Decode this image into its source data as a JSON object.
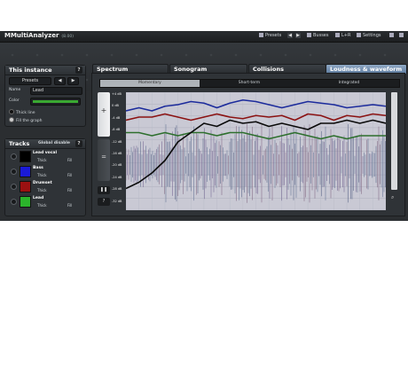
{
  "app": {
    "title": "MMultiAnalyzer",
    "version": "(8.00)"
  },
  "toolbar": {
    "presets_label": "Presets",
    "busses_label": "Busses",
    "lr_label": "L+R",
    "settings_label": "Settings"
  },
  "instance": {
    "header": "This instance",
    "help": "?",
    "presets_label": "Presets",
    "name_label": "Name",
    "name_value": "Lead",
    "color_label": "Color",
    "color_value": "#3aa832",
    "thick_line_label": "Thick line",
    "fill_graph_label": "Fill the graph"
  },
  "tracks": {
    "header": "Tracks",
    "global_label": "Global disable",
    "help": "?",
    "thick_label": "Thick",
    "fill_label": "Fill",
    "items": [
      {
        "name": "Lead vocal",
        "color": "#000000"
      },
      {
        "name": "Bass",
        "color": "#1a1ad6"
      },
      {
        "name": "Drumset",
        "color": "#9b1111"
      },
      {
        "name": "Lead",
        "color": "#2bb32b"
      }
    ]
  },
  "tabs": [
    {
      "label": "Spectrum",
      "active": false
    },
    {
      "label": "Sonogram",
      "active": false
    },
    {
      "label": "Collisions",
      "active": false
    },
    {
      "label": "Loudness & waveform",
      "active": true
    }
  ],
  "subtabs": [
    {
      "label": "Momentary",
      "active": true
    },
    {
      "label": "Short-term",
      "active": false
    },
    {
      "label": "Integrated",
      "active": false
    }
  ],
  "y_axis_labels": [
    "+4 dB",
    "0 dB",
    "-4 dB",
    "-8 dB",
    "-12 dB",
    "-16 dB",
    "-20 dB",
    "-24 dB",
    "-28 dB",
    "-32 dB"
  ],
  "chart_data": {
    "type": "line",
    "title": "",
    "xlabel": "",
    "ylabel": "",
    "ylim": [
      -34,
      4
    ],
    "x": [
      0,
      1,
      2,
      3,
      4,
      5,
      6,
      7,
      8,
      9,
      10,
      11,
      12,
      13,
      14,
      15,
      16,
      17,
      18,
      19,
      20
    ],
    "series": [
      {
        "color": "#1c2b9c",
        "values": [
          -2,
          -1,
          -2,
          -0.5,
          0,
          1,
          0.5,
          -1,
          0.5,
          1.5,
          1,
          0,
          -1,
          0,
          1,
          0.5,
          0,
          -1,
          -0.5,
          0,
          -0.5
        ]
      },
      {
        "color": "#8b1212",
        "values": [
          -5,
          -4,
          -4,
          -3,
          -4,
          -5,
          -4,
          -3,
          -4,
          -4.5,
          -3.5,
          -4,
          -3.5,
          -5,
          -3,
          -3.5,
          -5,
          -3.5,
          -4,
          -3,
          -3.5
        ]
      },
      {
        "color": "#2d6f2d",
        "values": [
          -9,
          -9,
          -10,
          -9,
          -10,
          -9,
          -9,
          -10,
          -9,
          -9,
          -10,
          -11,
          -10,
          -9,
          -10,
          -11,
          -10,
          -11,
          -10,
          -10,
          -10
        ]
      },
      {
        "color": "#0a0a0a",
        "values": [
          -27,
          -25,
          -22,
          -18,
          -12,
          -9,
          -6,
          -7,
          -5,
          -6,
          -5.5,
          -7,
          -6,
          -7,
          -8,
          -6,
          -6,
          -5,
          -6,
          -5,
          -6
        ]
      }
    ]
  }
}
